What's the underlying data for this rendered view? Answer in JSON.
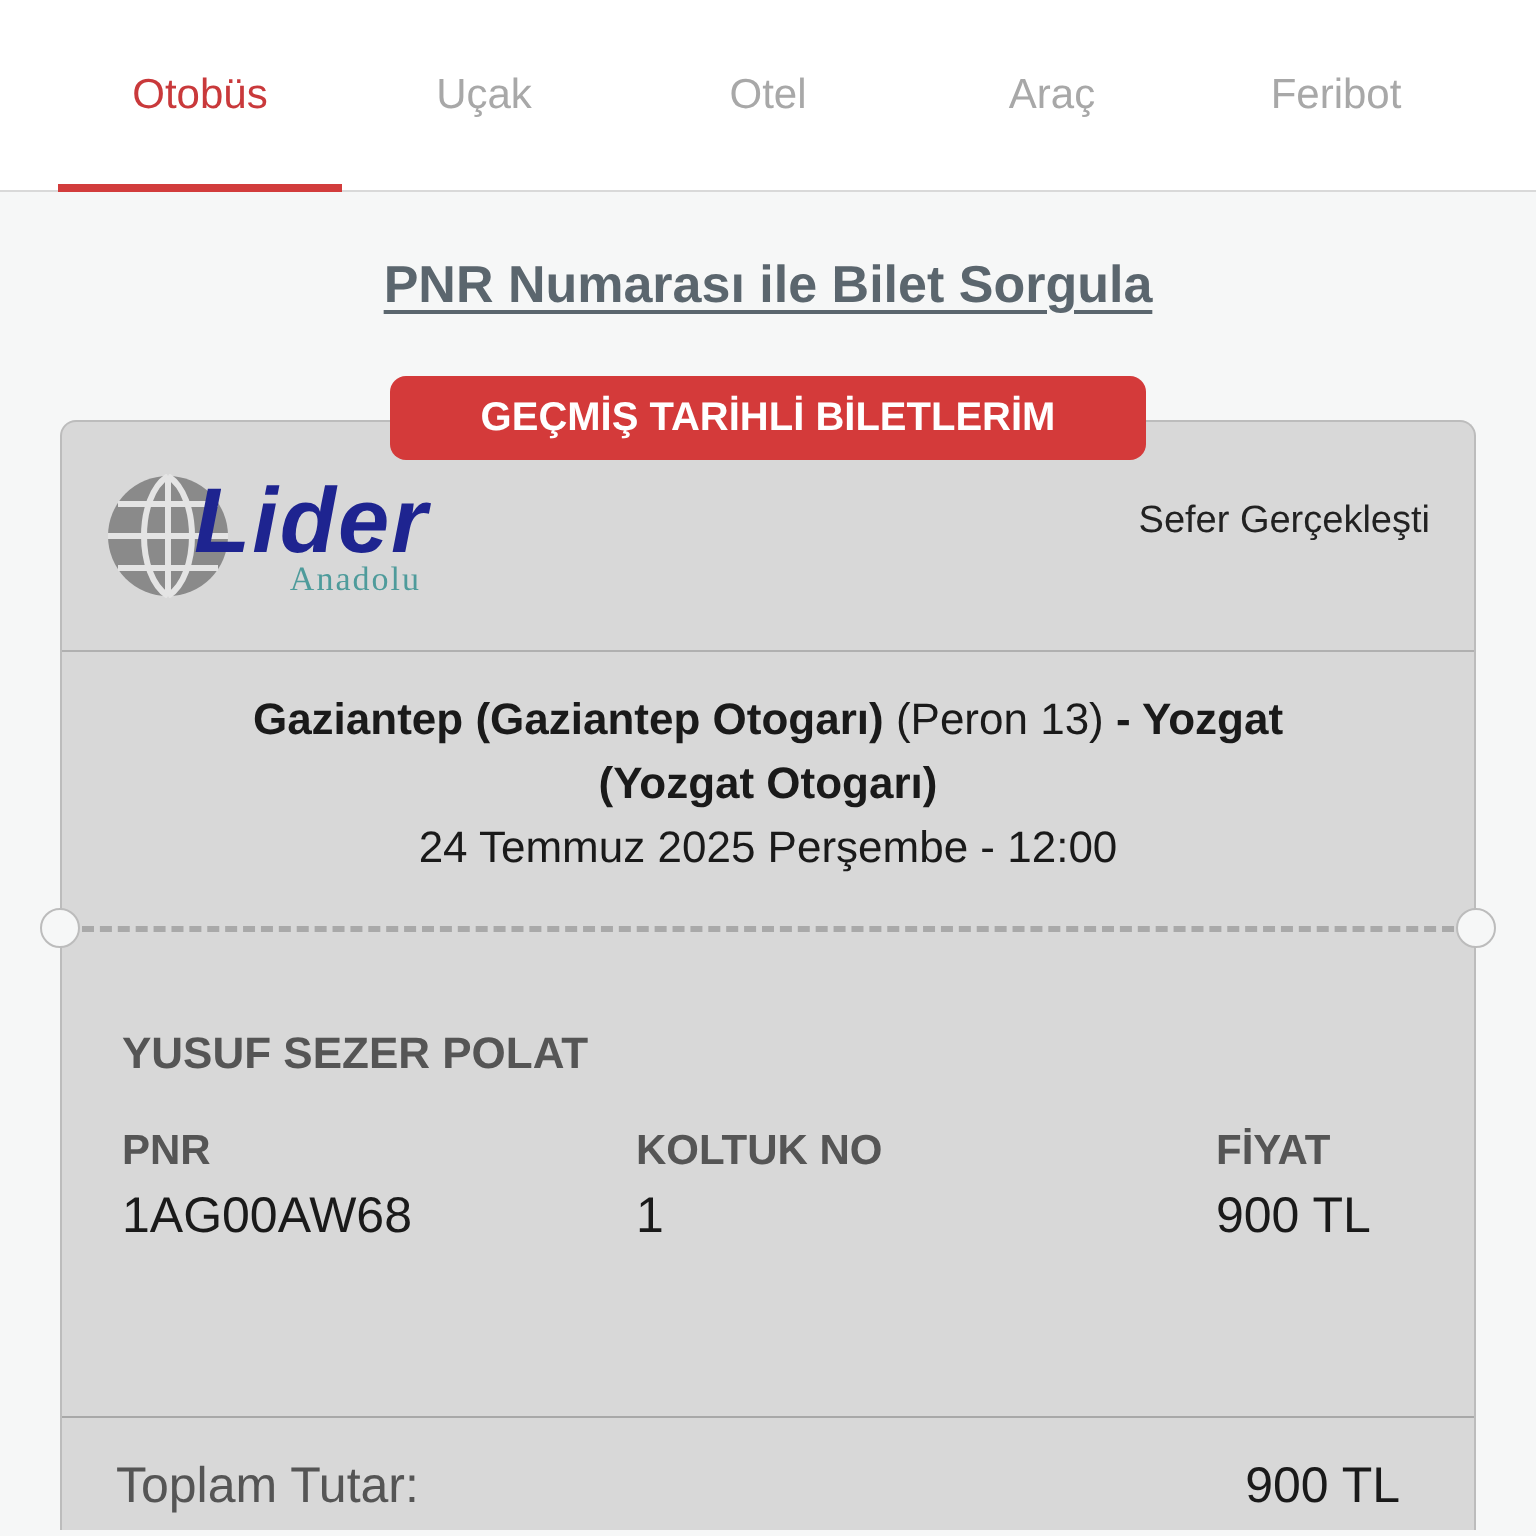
{
  "tabs": [
    {
      "label": "Otobüs",
      "selected": true
    },
    {
      "label": "Uçak",
      "selected": false
    },
    {
      "label": "Otel",
      "selected": false
    },
    {
      "label": "Araç",
      "selected": false
    },
    {
      "label": "Feribot",
      "selected": false
    }
  ],
  "query_link": "PNR Numarası ile Bilet Sorgula",
  "past_tickets_badge": "GEÇMİŞ TARİHLİ BİLETLERİM",
  "ticket": {
    "company_logo": {
      "name": "Lider",
      "subtitle": "Anadolu"
    },
    "status": "Sefer Gerçekleşti",
    "route": "**Gaziantep (Gaziantep Otogarı)** (Peron 13) **- Yozgat (Yozgat Otogarı)**",
    "datetime": "24 Temmuz 2025 Perşembe - 12:00",
    "passenger": "YUSUF SEZER POLAT",
    "fields": [
      {
        "label": "PNR",
        "value": "1AG00AW68"
      },
      {
        "label": "KOLTUK NO",
        "value": "1"
      },
      {
        "label": "FİYAT",
        "value": "900 TL"
      }
    ],
    "total": {
      "label": "Toplam Tutar:",
      "value": "900 TL"
    }
  }
}
